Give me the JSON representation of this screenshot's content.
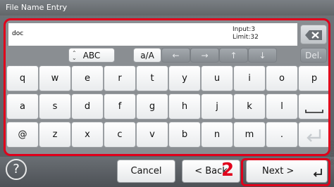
{
  "window": {
    "title": "File Name Entry"
  },
  "input": {
    "value": "doc",
    "input_count": "Input:3",
    "limit": "Limit:32"
  },
  "mode_row": {
    "charset": "ABC",
    "case": "a/A",
    "left": "←",
    "right": "→",
    "up": "↑",
    "down": "↓",
    "delete": "Del."
  },
  "keys": {
    "row1": [
      "q",
      "w",
      "e",
      "r",
      "t",
      "y",
      "u",
      "i",
      "o",
      "p"
    ],
    "row2": [
      "a",
      "s",
      "d",
      "f",
      "g",
      "h",
      "j",
      "k",
      "l"
    ],
    "row3": [
      "@",
      "z",
      "x",
      "c",
      "v",
      "b",
      "n",
      "m",
      "."
    ]
  },
  "bottom_bar": {
    "help": "?",
    "cancel": "Cancel",
    "back": "< Back",
    "next": "Next >",
    "callout": "2"
  },
  "serial": "G00075_00",
  "colors": {
    "highlight": "#e0001b",
    "panel": "#8a8e92"
  },
  "icons": [
    "backspace-icon",
    "space-icon",
    "enter-icon",
    "help-icon",
    "enter-arrow-icon"
  ]
}
